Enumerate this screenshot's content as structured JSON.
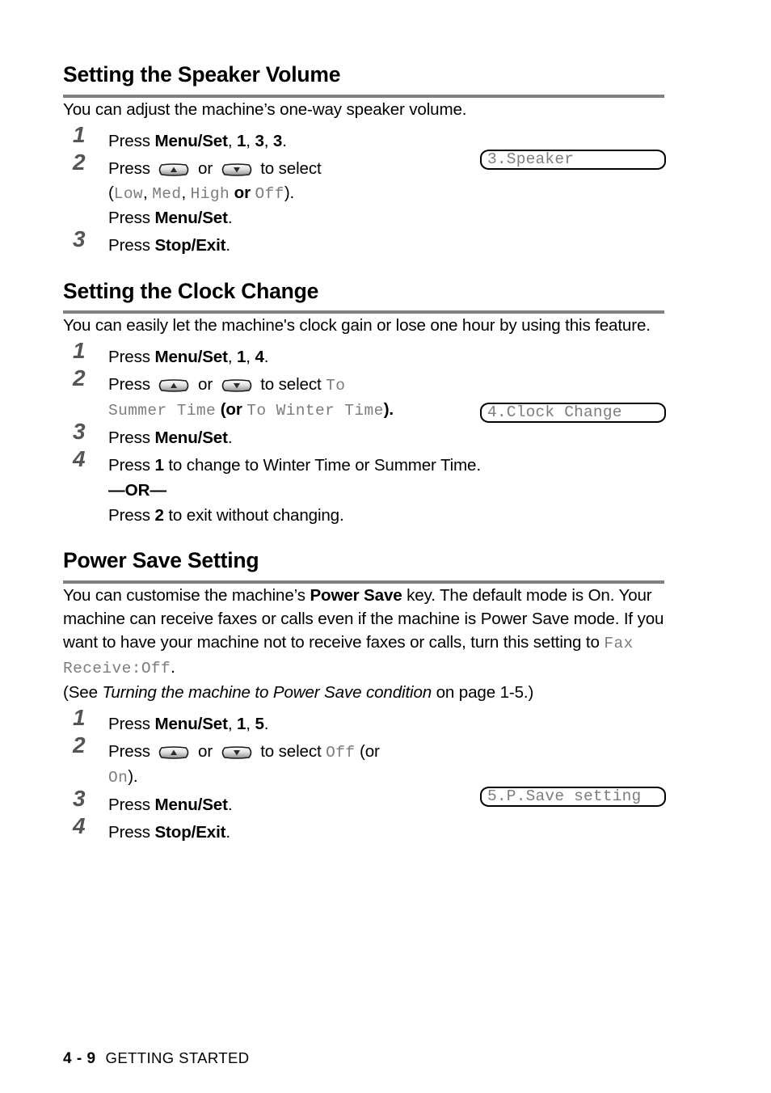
{
  "page": {
    "footer_page_number": "4 - 9",
    "footer_label": "GETTING STARTED"
  },
  "colors": {
    "rule": "#808080",
    "lcd_text": "#7d7d7d",
    "step_number": "#555555",
    "text": "#000000"
  },
  "sections": [
    {
      "id": "speaker-volume",
      "title": "Setting the Speaker Volume",
      "intro": "You can adjust the machine’s one-way speaker volume.",
      "lcd": "3.Speaker",
      "steps": {
        "n1": "1",
        "n2": "2",
        "n3": "3",
        "s1_press": "Press ",
        "s1_menuset": "Menu/Set",
        "s1_comma1": ", ",
        "s1_d1": "1",
        "s1_comma2": ", ",
        "s1_d2": "3",
        "s1_comma3": ", ",
        "s1_d3": "3",
        "s1_period": ".",
        "s2_press": "Press ",
        "s2_or": " or ",
        "s2_toselect": " to select",
        "s2_open": "(",
        "s2_low": "Low",
        "s2_sep1": ", ",
        "s2_med": "Med",
        "s2_sep2": ", ",
        "s2_high": "High",
        "s2_orword": " or ",
        "s2_off": "Off",
        "s2_close": ").",
        "s2_press2": "Press ",
        "s2_menuset2": "Menu/Set",
        "s2_period2": ".",
        "s3_press": "Press ",
        "s3_stopexit": "Stop/Exit",
        "s3_period": "."
      }
    },
    {
      "id": "clock-change",
      "title": "Setting the Clock Change",
      "intro": "You can easily let the machine's clock gain or lose one hour by using this feature.",
      "lcd": "4.Clock Change",
      "steps": {
        "n1": "1",
        "n2": "2",
        "n3": "3",
        "n4": "4",
        "s1_press": "Press ",
        "s1_menuset": "Menu/Set",
        "s1_comma1": ", ",
        "s1_d1": "1",
        "s1_comma2": ", ",
        "s1_d2": "4",
        "s1_period": ".",
        "s2_press": "Press ",
        "s2_or": " or ",
        "s2_toselect": " to select ",
        "s2_to": "To",
        "s2_summertime": "Summer Time",
        "s2_orbold": " (or ",
        "s2_towintertime": "To Winter Time",
        "s2_close": ").",
        "s3_press": "Press ",
        "s3_menuset": "Menu/Set",
        "s3_period": ".",
        "s4_pre": "Press ",
        "s4_digit": "1",
        "s4_post": " to change to Winter Time or Summer Time.",
        "s4_or_sep_left": "—",
        "s4_or_sep_word": "OR",
        "s4_or_sep_right": "—",
        "s4_alt_pre": "Press ",
        "s4_alt_digit": "2",
        "s4_alt_post": " to exit without changing."
      }
    },
    {
      "id": "power-save",
      "title": "Power Save Setting",
      "intro_p1": "You can customise the machine’s ",
      "intro_powersave": "Power Save",
      "intro_p2": " key. The default mode is On. Your machine can receive faxes or calls even if the machine is Power Save mode. If you want to have your machine not to receive faxes or calls, turn this setting to ",
      "intro_faxreceive": "Fax Receive:Off",
      "intro_p3": ".",
      "intro_see": "(See ",
      "intro_italic": "Turning the machine to Power Save condition",
      "intro_page": " on page 1-5.)",
      "lcd": "5.P.Save setting",
      "steps": {
        "n1": "1",
        "n2": "2",
        "n3": "3",
        "n4": "4",
        "s1_press": "Press ",
        "s1_menuset": "Menu/Set",
        "s1_comma1": ", ",
        "s1_d1": "1",
        "s1_comma2": ", ",
        "s1_d2": "5",
        "s1_period": ".",
        "s2_press": "Press ",
        "s2_or": " or ",
        "s2_toselect": " to select ",
        "s2_off": "Off",
        "s2_oropen": " (or",
        "s2_on": "On",
        "s2_close": ").",
        "s3_press": "Press ",
        "s3_menuset": "Menu/Set",
        "s3_period": ".",
        "s4_press": "Press ",
        "s4_stopexit": "Stop/Exit",
        "s4_period": "."
      }
    }
  ],
  "icons": {
    "arrow_up": "arrow-up-key",
    "arrow_down": "arrow-down-key"
  }
}
